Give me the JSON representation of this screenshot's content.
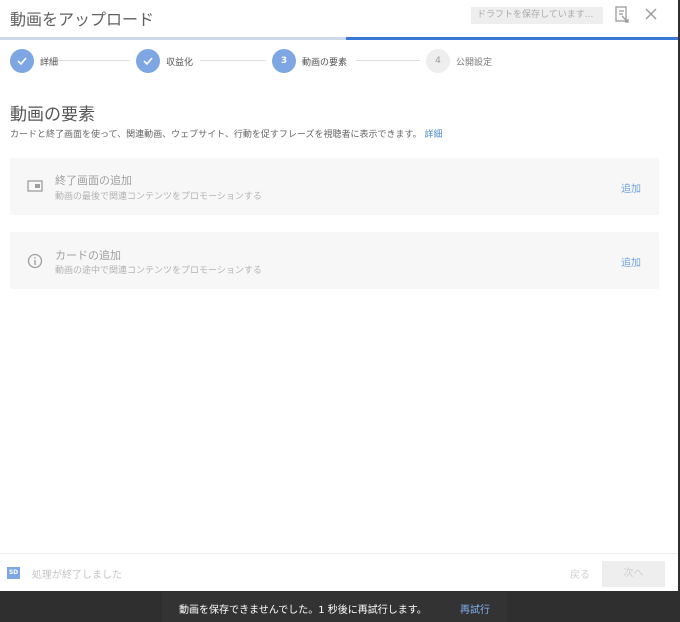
{
  "header": {
    "title": "動画をアップロード",
    "draft_status": "ドラフトを保存しています...",
    "feedback_icon": "feedback-icon",
    "close_icon": "close-icon",
    "progress_fraction": 0.51
  },
  "stepper": {
    "steps": [
      {
        "number": "",
        "label": "詳細",
        "state": "done"
      },
      {
        "number": "",
        "label": "収益化",
        "state": "done"
      },
      {
        "number": "3",
        "label": "動画の要素",
        "state": "current"
      },
      {
        "number": "4",
        "label": "公開設定",
        "state": "pending"
      }
    ]
  },
  "main": {
    "title": "動画の要素",
    "description": "カードと終了画面を使って、関連動画、ウェブサイト、行動を促すフレーズを視聴者に表示できます。",
    "description_link": "詳細",
    "cards": [
      {
        "icon": "end-screen-icon",
        "title": "終了画面の追加",
        "subtitle": "動画の最後で関連コンテンツをプロモーションする",
        "action": "追加"
      },
      {
        "icon": "info-icon",
        "title": "カードの追加",
        "subtitle": "動画の途中で関連コンテンツをプロモーションする",
        "action": "追加"
      }
    ]
  },
  "footer": {
    "status_badge": "SD",
    "status_text": "処理が終了しました",
    "back_label": "戻る",
    "next_label": "次へ"
  },
  "snackbar": {
    "message": "動画を保存できませんでした。1 秒後に再試行します。",
    "action": "再試行"
  },
  "colors": {
    "accent": "#3a78d8",
    "step_active": "#7ea6e2",
    "link": "#4a8ad8"
  }
}
